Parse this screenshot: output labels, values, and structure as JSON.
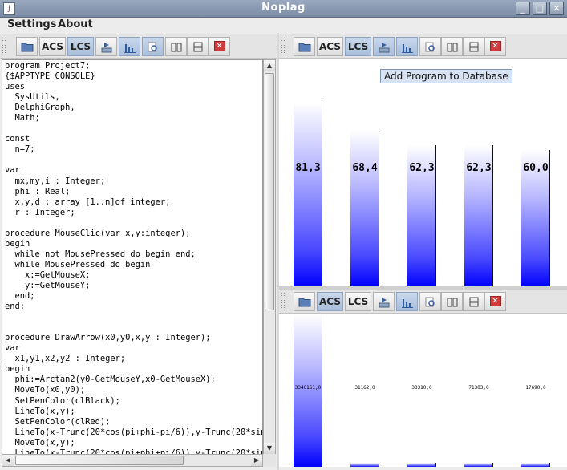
{
  "window": {
    "title": "Noplag",
    "icon_glyph": "J"
  },
  "menu": {
    "items": [
      "Settings",
      "About"
    ]
  },
  "toolbar": {
    "acs_label": "ACS",
    "lcs_label": "LCS"
  },
  "editor": {
    "lines": [
      "program Project7;",
      "{$APPTYPE CONSOLE}",
      "uses",
      "  SysUtils,",
      "  DelphiGraph,",
      "  Math;",
      "",
      "const",
      "  n=7;",
      "",
      "var",
      "  mx,my,i : Integer;",
      "  phi : Real;",
      "  x,y,d : array [1..n]of integer;",
      "  r : Integer;",
      "",
      "procedure MouseClic(var x,y:integer);",
      "begin",
      "  while not MousePressed do begin end;",
      "  while MousePressed do begin",
      "    x:=GetMouseX;",
      "    y:=GetMouseY;",
      "  end;",
      "end;",
      "",
      "",
      "procedure DrawArrow(x0,y0,x,y : Integer);",
      "var",
      "  x1,y1,x2,y2 : Integer;",
      "begin",
      "  phi:=Arctan2(y0-GetMouseY,x0-GetMouseX);",
      "  MoveTo(x0,y0);",
      "  SetPenColor(clBlack);",
      "  LineTo(x,y);",
      "  SetPenColor(clRed);",
      "  LineTo(x-Trunc(20*cos(pi+phi-pi/6)),y-Trunc(20*sin(pi",
      "  MoveTo(x,y);",
      "  LineTo(x-Trunc(20*cos(pi+phi+pi/6)),y-Trunc(20*sin(pi"
    ]
  },
  "top_chart": {
    "tooltip": "Add Program to Database",
    "chart_data": {
      "type": "bar",
      "labels": [
        "81,3",
        "68,4",
        "62,3",
        "62,3",
        "60,0"
      ],
      "values": [
        81.3,
        68.4,
        62.3,
        62.3,
        60.0
      ],
      "ylim": [
        0,
        100
      ]
    }
  },
  "bottom_chart": {
    "chart_data": {
      "type": "bar",
      "labels": [
        "3340161,0",
        "31162,0",
        "33310,0",
        "71303,0",
        "17690,0"
      ],
      "values": [
        3340161,
        31162,
        33310,
        71303,
        17690
      ]
    }
  }
}
